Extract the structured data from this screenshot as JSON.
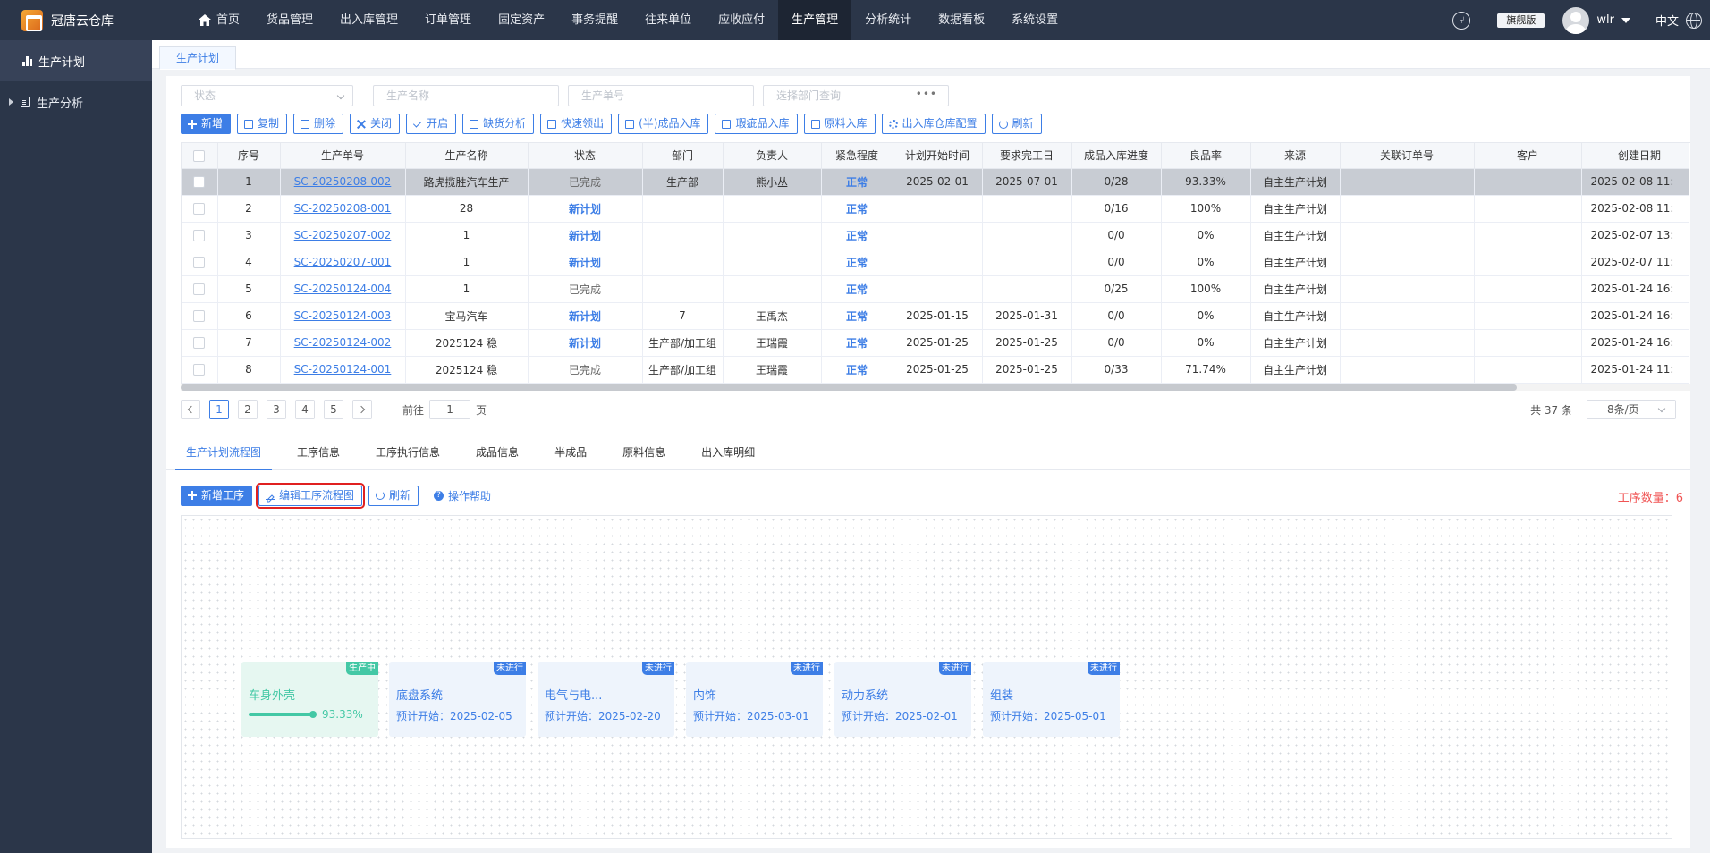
{
  "app": {
    "name": "冠唐云仓库"
  },
  "nav": {
    "items": [
      "首页",
      "货品管理",
      "出入库管理",
      "订单管理",
      "固定资产",
      "事务提醒",
      "往来单位",
      "应收应付",
      "生产管理",
      "分析统计",
      "数据看板",
      "系统设置"
    ],
    "active": "生产管理"
  },
  "topright": {
    "edition": "旗舰版",
    "user": "wlr",
    "lang": "中文"
  },
  "sidebar": {
    "items": [
      {
        "label": "生产计划"
      },
      {
        "label": "生产分析"
      }
    ]
  },
  "page_tab": "生产计划",
  "filters": {
    "status": "状态",
    "name": "生产名称",
    "number": "生产单号",
    "dept": "选择部门查询"
  },
  "toolbar": [
    "新增",
    "复制",
    "删除",
    "关闭",
    "开启",
    "缺货分析",
    "快速领出",
    "(半)成品入库",
    "瑕疵品入库",
    "原料入库",
    "出入库仓库配置",
    "刷新"
  ],
  "table": {
    "headers": [
      "序号",
      "生产单号",
      "生产名称",
      "状态",
      "部门",
      "负责人",
      "紧急程度",
      "计划开始时间",
      "要求完工日",
      "成品入库进度",
      "良品率",
      "来源",
      "关联订单号",
      "客户",
      "创建日期"
    ],
    "rows": [
      [
        "1",
        "SC-20250208-002",
        "路虎揽胜汽车生产",
        "已完成",
        "生产部",
        "熊小丛",
        "正常",
        "2025-02-01",
        "2025-07-01",
        "0/28",
        "93.33%",
        "自主生产计划",
        "",
        "",
        "2025-02-08 11:"
      ],
      [
        "2",
        "SC-20250208-001",
        "28",
        "新计划",
        "",
        "",
        "正常",
        "",
        "",
        "0/16",
        "100%",
        "自主生产计划",
        "",
        "",
        "2025-02-08 11:"
      ],
      [
        "3",
        "SC-20250207-002",
        "1",
        "新计划",
        "",
        "",
        "正常",
        "",
        "",
        "0/0",
        "0%",
        "自主生产计划",
        "",
        "",
        "2025-02-07 13:"
      ],
      [
        "4",
        "SC-20250207-001",
        "1",
        "新计划",
        "",
        "",
        "正常",
        "",
        "",
        "0/0",
        "0%",
        "自主生产计划",
        "",
        "",
        "2025-02-07 11:"
      ],
      [
        "5",
        "SC-20250124-004",
        "1",
        "已完成",
        "",
        "",
        "正常",
        "",
        "",
        "0/25",
        "100%",
        "自主生产计划",
        "",
        "",
        "2025-01-24 16:"
      ],
      [
        "6",
        "SC-20250124-003",
        "宝马汽车",
        "新计划",
        "7",
        "王禹杰",
        "正常",
        "2025-01-15",
        "2025-01-31",
        "0/0",
        "0%",
        "自主生产计划",
        "",
        "",
        "2025-01-24 16:"
      ],
      [
        "7",
        "SC-20250124-002",
        "2025124 稳",
        "新计划",
        "生产部/加工组",
        "王瑞霞",
        "正常",
        "2025-01-25",
        "2025-01-25",
        "0/0",
        "0%",
        "自主生产计划",
        "",
        "",
        "2025-01-24 16:"
      ],
      [
        "8",
        "SC-20250124-001",
        "2025124 稳",
        "已完成",
        "生产部/加工组",
        "王瑞霞",
        "正常",
        "2025-01-25",
        "2025-01-25",
        "0/33",
        "71.74%",
        "自主生产计划",
        "",
        "",
        "2025-01-24 11:"
      ]
    ]
  },
  "pager": {
    "pages": [
      "1",
      "2",
      "3",
      "4",
      "5"
    ],
    "current": "1",
    "goto_prefix": "前往",
    "goto_value": "1",
    "goto_suffix": "页",
    "total": "共 37 条",
    "page_size": "8条/页"
  },
  "sub_tabs": [
    "生产计划流程图",
    "工序信息",
    "工序执行信息",
    "成品信息",
    "半成品",
    "原料信息",
    "出入库明细"
  ],
  "flow": {
    "buttons": {
      "add": "新增工序",
      "edit": "编辑工序流程图",
      "refresh": "刷新"
    },
    "help": "操作帮助",
    "count_label": "工序数量：6",
    "nodes": [
      {
        "name": "车身外壳",
        "tag": "生产中",
        "progress_text": "93.33%",
        "progress": 0.9333
      },
      {
        "name": "底盘系统",
        "tag": "未进行",
        "start": "预计开始：2025-02-05"
      },
      {
        "name": "电气与电...",
        "tag": "未进行",
        "start": "预计开始：2025-02-20"
      },
      {
        "name": "内饰",
        "tag": "未进行",
        "start": "预计开始：2025-03-01"
      },
      {
        "name": "动力系统",
        "tag": "未进行",
        "start": "预计开始：2025-02-01"
      },
      {
        "name": "组装",
        "tag": "未进行",
        "start": "预计开始：2025-05-01"
      }
    ]
  }
}
